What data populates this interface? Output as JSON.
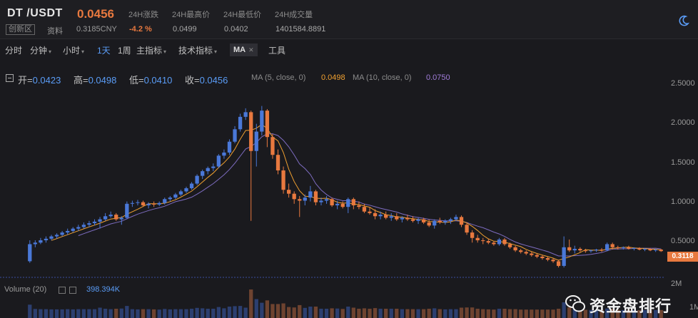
{
  "header": {
    "pair": "DT /USDT",
    "price": "0.0456",
    "badge": "创新区",
    "info_link": "资料",
    "cny": "0.3185CNY",
    "stats": [
      {
        "label": "24H涨跌",
        "value": "-4.2 %"
      },
      {
        "label": "24H最高价",
        "value": "0.0499"
      },
      {
        "label": "24H最低价",
        "value": "0.0402"
      },
      {
        "label": "24H成交量",
        "value": "1401584.8891"
      }
    ],
    "theme_icon": "moon-icon"
  },
  "toolbar": {
    "items": [
      "分时",
      "分钟",
      "小时",
      "1天",
      "1周",
      "主指标",
      "技术指标"
    ],
    "ma_chip": "MA",
    "tools": "工具"
  },
  "ohlc": {
    "open_label": "开=",
    "open": "0.0423",
    "high_label": "高=",
    "high": "0.0498",
    "low_label": "低=",
    "low": "0.0410",
    "close_label": "收=",
    "close": "0.0456"
  },
  "ma_info": {
    "ma5_label": "MA (5, close, 0)",
    "ma5_value": "0.0498",
    "ma10_label": "MA (10, close, 0)",
    "ma10_value": "0.0750"
  },
  "y_axis": [
    "2.5000",
    "2.0000",
    "1.5000",
    "1.0000",
    "0.5000"
  ],
  "last_price_tag": "0.3118",
  "volume": {
    "label": "Volume (20)",
    "value": "398.394K",
    "axis_2m": "2M",
    "axis_1m": "1M"
  },
  "watermark": "资金盘排行",
  "colors": {
    "up": "#4a78d8",
    "down": "#e8793f",
    "ma5": "#f0a030",
    "ma10": "#7d6cc0",
    "background": "#1a1a1e"
  },
  "chart_data": {
    "type": "candlestick",
    "ylim": [
      0,
      2.7
    ],
    "candles_ohlc": [
      [
        0.18,
        0.45,
        0.16,
        0.4
      ],
      [
        0.4,
        0.45,
        0.36,
        0.42
      ],
      [
        0.42,
        0.48,
        0.4,
        0.45
      ],
      [
        0.45,
        0.5,
        0.42,
        0.47
      ],
      [
        0.47,
        0.52,
        0.45,
        0.5
      ],
      [
        0.5,
        0.54,
        0.47,
        0.52
      ],
      [
        0.52,
        0.57,
        0.5,
        0.55
      ],
      [
        0.55,
        0.6,
        0.52,
        0.57
      ],
      [
        0.57,
        0.62,
        0.55,
        0.6
      ],
      [
        0.6,
        0.65,
        0.57,
        0.62
      ],
      [
        0.62,
        0.68,
        0.6,
        0.65
      ],
      [
        0.65,
        0.7,
        0.62,
        0.67
      ],
      [
        0.67,
        0.72,
        0.64,
        0.69
      ],
      [
        0.69,
        0.75,
        0.6,
        0.72
      ],
      [
        0.72,
        0.8,
        0.7,
        0.76
      ],
      [
        0.76,
        0.82,
        0.74,
        0.78
      ],
      [
        0.78,
        0.8,
        0.7,
        0.72
      ],
      [
        0.72,
        0.76,
        0.65,
        0.74
      ],
      [
        0.74,
        0.95,
        0.72,
        0.92
      ],
      [
        0.92,
        0.96,
        0.88,
        0.93
      ],
      [
        0.93,
        0.97,
        0.9,
        0.94
      ],
      [
        0.94,
        0.96,
        0.88,
        0.9
      ],
      [
        0.9,
        0.94,
        0.86,
        0.92
      ],
      [
        0.92,
        0.95,
        0.88,
        0.91
      ],
      [
        0.91,
        0.95,
        0.89,
        0.93
      ],
      [
        0.93,
        1.0,
        0.91,
        0.98
      ],
      [
        0.98,
        1.02,
        0.95,
        1.0
      ],
      [
        1.0,
        1.06,
        0.98,
        1.04
      ],
      [
        1.04,
        1.1,
        1.02,
        1.08
      ],
      [
        1.08,
        1.14,
        1.06,
        1.12
      ],
      [
        1.12,
        1.2,
        1.1,
        1.18
      ],
      [
        1.18,
        1.3,
        1.16,
        1.28
      ],
      [
        1.28,
        1.36,
        1.24,
        1.34
      ],
      [
        1.34,
        1.4,
        1.3,
        1.38
      ],
      [
        1.38,
        1.44,
        1.34,
        1.4
      ],
      [
        1.4,
        1.56,
        1.38,
        1.54
      ],
      [
        1.54,
        1.62,
        1.5,
        1.58
      ],
      [
        1.58,
        1.75,
        1.55,
        1.72
      ],
      [
        1.72,
        1.92,
        1.7,
        1.88
      ],
      [
        1.88,
        2.08,
        1.85,
        2.04
      ],
      [
        2.04,
        2.15,
        2.0,
        2.1
      ],
      [
        2.1,
        2.12,
        0.7,
        1.6
      ],
      [
        1.6,
        1.95,
        1.4,
        1.85
      ],
      [
        1.85,
        2.18,
        1.8,
        2.12
      ],
      [
        2.12,
        2.14,
        1.65,
        1.78
      ],
      [
        1.78,
        1.82,
        1.5,
        1.55
      ],
      [
        1.55,
        1.62,
        1.3,
        1.35
      ],
      [
        1.35,
        1.4,
        1.05,
        1.1
      ],
      [
        1.1,
        1.18,
        1.0,
        1.05
      ],
      [
        1.05,
        1.08,
        0.92,
        0.98
      ],
      [
        0.98,
        1.02,
        0.75,
        0.96
      ],
      [
        0.96,
        1.04,
        0.9,
        1.0
      ],
      [
        1.0,
        1.15,
        0.95,
        1.08
      ],
      [
        1.08,
        1.1,
        0.9,
        0.94
      ],
      [
        0.94,
        1.0,
        0.9,
        0.96
      ],
      [
        0.96,
        1.02,
        0.92,
        0.98
      ],
      [
        0.98,
        1.0,
        0.88,
        0.9
      ],
      [
        0.9,
        0.96,
        0.85,
        0.92
      ],
      [
        0.92,
        0.95,
        0.86,
        0.88
      ],
      [
        0.88,
        1.0,
        0.8,
        0.98
      ],
      [
        0.98,
        1.0,
        0.85,
        0.9
      ],
      [
        0.9,
        0.95,
        0.85,
        0.88
      ],
      [
        0.88,
        0.92,
        0.8,
        0.82
      ],
      [
        0.82,
        0.88,
        0.78,
        0.8
      ],
      [
        0.8,
        0.85,
        0.72,
        0.76
      ],
      [
        0.76,
        0.82,
        0.72,
        0.78
      ],
      [
        0.78,
        0.82,
        0.72,
        0.74
      ],
      [
        0.74,
        0.8,
        0.7,
        0.76
      ],
      [
        0.76,
        0.8,
        0.7,
        0.72
      ],
      [
        0.72,
        0.76,
        0.68,
        0.74
      ],
      [
        0.74,
        0.78,
        0.7,
        0.72
      ],
      [
        0.72,
        0.76,
        0.68,
        0.7
      ],
      [
        0.7,
        0.74,
        0.66,
        0.72
      ],
      [
        0.72,
        0.74,
        0.66,
        0.68
      ],
      [
        0.68,
        0.72,
        0.62,
        0.64
      ],
      [
        0.64,
        0.72,
        0.6,
        0.7
      ],
      [
        0.7,
        0.74,
        0.66,
        0.68
      ],
      [
        0.68,
        0.72,
        0.65,
        0.7
      ],
      [
        0.7,
        0.74,
        0.66,
        0.72
      ],
      [
        0.72,
        0.78,
        0.7,
        0.75
      ],
      [
        0.75,
        0.77,
        0.62,
        0.65
      ],
      [
        0.65,
        0.68,
        0.52,
        0.55
      ],
      [
        0.55,
        0.58,
        0.42,
        0.48
      ],
      [
        0.48,
        0.52,
        0.42,
        0.45
      ],
      [
        0.45,
        0.48,
        0.4,
        0.44
      ],
      [
        0.44,
        0.47,
        0.4,
        0.42
      ],
      [
        0.42,
        0.44,
        0.38,
        0.4
      ],
      [
        0.4,
        0.48,
        0.38,
        0.46
      ],
      [
        0.46,
        0.48,
        0.38,
        0.4
      ],
      [
        0.4,
        0.42,
        0.34,
        0.36
      ],
      [
        0.36,
        0.38,
        0.3,
        0.32
      ],
      [
        0.32,
        0.34,
        0.28,
        0.3
      ],
      [
        0.3,
        0.32,
        0.26,
        0.28
      ],
      [
        0.28,
        0.3,
        0.24,
        0.26
      ],
      [
        0.26,
        0.28,
        0.22,
        0.24
      ],
      [
        0.24,
        0.26,
        0.2,
        0.22
      ],
      [
        0.22,
        0.24,
        0.18,
        0.2
      ],
      [
        0.2,
        0.22,
        0.16,
        0.18
      ],
      [
        0.18,
        0.2,
        0.1,
        0.12
      ],
      [
        0.12,
        0.5,
        0.1,
        0.36
      ],
      [
        0.36,
        0.46,
        0.3,
        0.32
      ],
      [
        0.32,
        0.38,
        0.28,
        0.34
      ],
      [
        0.34,
        0.36,
        0.3,
        0.32
      ],
      [
        0.32,
        0.34,
        0.29,
        0.31
      ],
      [
        0.31,
        0.33,
        0.29,
        0.32
      ],
      [
        0.32,
        0.34,
        0.3,
        0.33
      ],
      [
        0.33,
        0.35,
        0.3,
        0.32
      ],
      [
        0.32,
        0.42,
        0.31,
        0.4
      ],
      [
        0.4,
        0.42,
        0.33,
        0.36
      ],
      [
        0.36,
        0.38,
        0.33,
        0.35
      ],
      [
        0.35,
        0.37,
        0.33,
        0.36
      ],
      [
        0.36,
        0.38,
        0.33,
        0.34
      ],
      [
        0.34,
        0.36,
        0.32,
        0.35
      ],
      [
        0.35,
        0.36,
        0.32,
        0.33
      ],
      [
        0.33,
        0.35,
        0.31,
        0.34
      ],
      [
        0.34,
        0.35,
        0.31,
        0.32
      ],
      [
        0.32,
        0.34,
        0.3,
        0.33
      ],
      [
        0.33,
        0.34,
        0.3,
        0.31
      ]
    ]
  }
}
